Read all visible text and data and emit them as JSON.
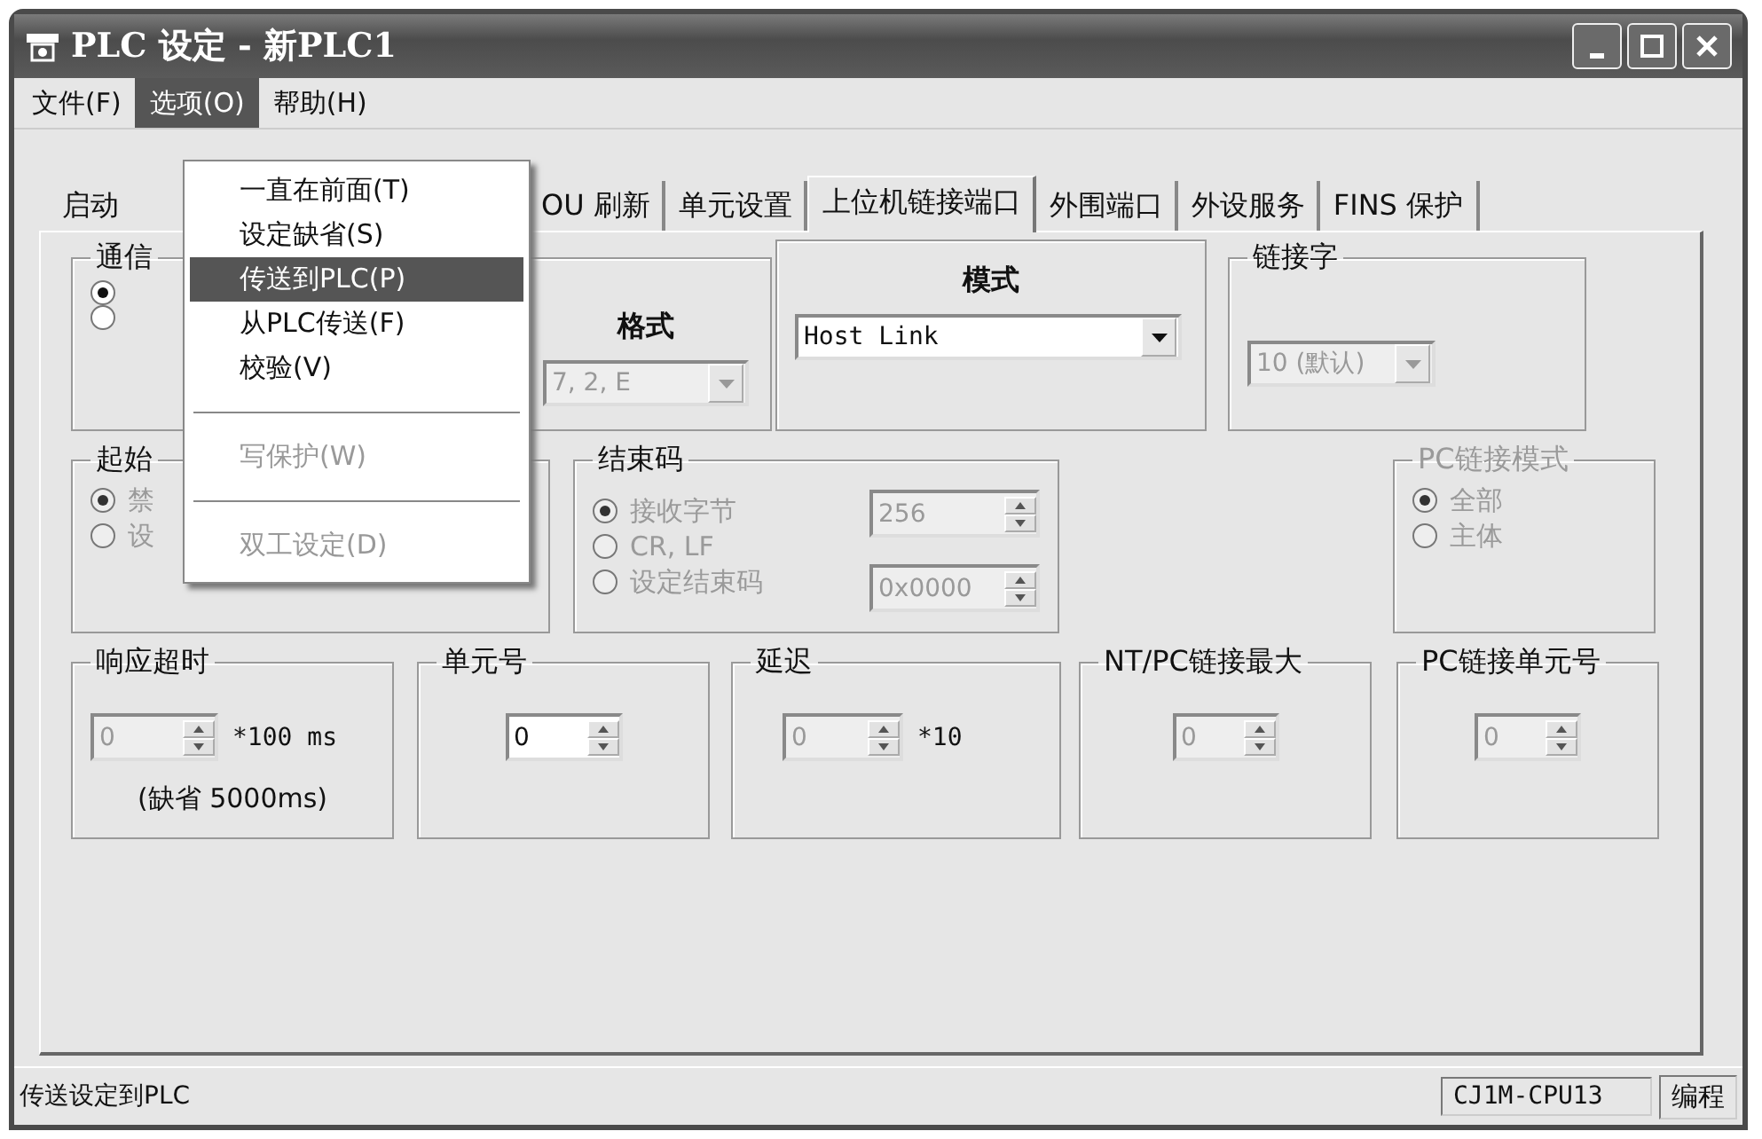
{
  "window": {
    "title": "PLC 设定 - 新PLC1"
  },
  "menu_bar": [
    {
      "label": "文件(F)",
      "selected": false
    },
    {
      "label": "选项(O)",
      "selected": true
    },
    {
      "label": "帮助(H)",
      "selected": false
    }
  ],
  "dropdown_menu": [
    {
      "kind": "item",
      "label": "一直在前面(T)",
      "selected": false,
      "disabled": false
    },
    {
      "kind": "item",
      "label": "设定缺省(S)",
      "selected": false,
      "disabled": false
    },
    {
      "kind": "item",
      "label": "传送到PLC(P)",
      "selected": true,
      "disabled": false
    },
    {
      "kind": "item",
      "label": "从PLC传送(F)",
      "selected": false,
      "disabled": false
    },
    {
      "kind": "item",
      "label": "校验(V)",
      "selected": false,
      "disabled": false
    },
    {
      "kind": "separator"
    },
    {
      "kind": "item",
      "label": "写保护(W)",
      "selected": false,
      "disabled": true
    },
    {
      "kind": "separator"
    },
    {
      "kind": "item",
      "label": "双工设定(D)",
      "selected": false,
      "disabled": true
    }
  ],
  "tabs": [
    {
      "label": "启动",
      "selected": false
    },
    {
      "label": "OU 刷新",
      "selected": false
    },
    {
      "label": "单元设置",
      "selected": false
    },
    {
      "label": "上位机链接端口",
      "selected": true
    },
    {
      "label": "外围端口",
      "selected": false
    },
    {
      "label": "外设服务",
      "selected": false
    },
    {
      "label": "FINS 保护",
      "selected": false
    }
  ],
  "tab_page": {
    "comm": {
      "title": "通信",
      "radios": [
        {
          "selected": true,
          "disabled": false
        },
        {
          "selected": false,
          "disabled": false
        }
      ],
      "format_label": "格式",
      "format": {
        "value": "7, 2, E",
        "disabled": true
      }
    },
    "mode": {
      "label": "模式",
      "value": "Host Link",
      "disabled": false
    },
    "link_words": {
      "title": "链接字",
      "value": "10 (默认)",
      "disabled": true
    },
    "start_code": {
      "title": "起始",
      "radios": [
        {
          "label": "禁",
          "selected": true,
          "disabled": true
        },
        {
          "label": "设",
          "selected": false,
          "disabled": true
        }
      ]
    },
    "end_code": {
      "title": "结束码",
      "radios": [
        {
          "label": "接收字节",
          "selected": true,
          "disabled": true
        },
        {
          "label": "CR, LF",
          "selected": false,
          "disabled": true
        },
        {
          "label": "设定结束码",
          "selected": false,
          "disabled": true
        }
      ],
      "received_bytes": {
        "value": "256",
        "disabled": true
      },
      "end_code_value": {
        "value": "0x0000",
        "disabled": true
      }
    },
    "pc_link_mode": {
      "title": "PC链接模式",
      "disabled": true,
      "radios": [
        {
          "label": "全部",
          "selected": true,
          "disabled": true
        },
        {
          "label": "主体",
          "selected": false,
          "disabled": true
        }
      ]
    },
    "response_timeout": {
      "title": "响应超时",
      "value": "0",
      "disabled": true,
      "unit": "*100 ms",
      "note": "(缺省 5000ms)"
    },
    "unit_number": {
      "title": "单元号",
      "value": "0",
      "disabled": false
    },
    "delay": {
      "title": "延迟",
      "value": "0",
      "disabled": true,
      "unit": "*10"
    },
    "nt_pc_link_max": {
      "title": "NT/PC链接最大",
      "value": "0",
      "disabled": true
    },
    "pc_link_unit_number": {
      "title": "PC链接单元号",
      "value": "0",
      "disabled": true
    }
  },
  "status_bar": {
    "message": "传送设定到PLC",
    "model": "CJ1M-CPU13",
    "mode": "编程"
  }
}
